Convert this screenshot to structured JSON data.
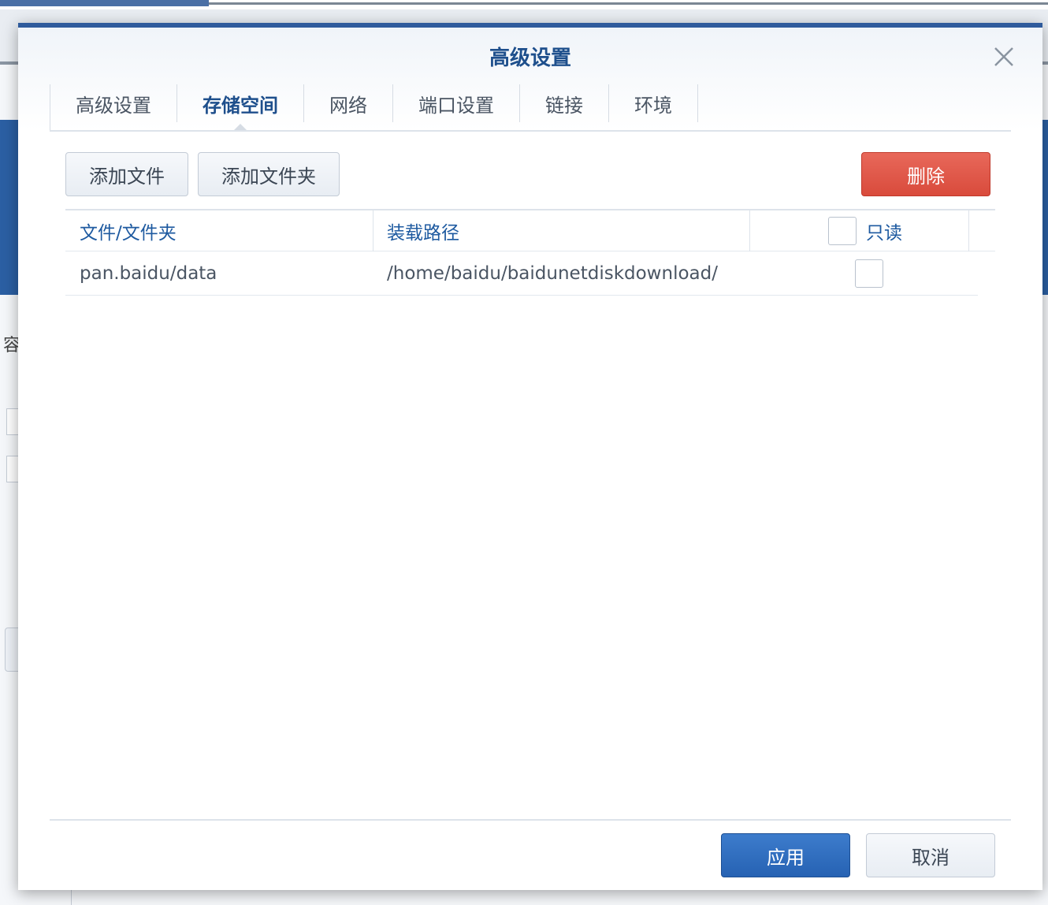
{
  "background": {
    "side_text": "容"
  },
  "dialog": {
    "title": "高级设置",
    "tabs": [
      {
        "label": "高级设置",
        "active": false
      },
      {
        "label": "存储空间",
        "active": true
      },
      {
        "label": "网络",
        "active": false
      },
      {
        "label": "端口设置",
        "active": false
      },
      {
        "label": "链接",
        "active": false
      },
      {
        "label": "环境",
        "active": false
      }
    ],
    "toolbar": {
      "add_file": "添加文件",
      "add_folder": "添加文件夹",
      "delete": "删除"
    },
    "table": {
      "columns": [
        "文件/文件夹",
        "装载路径",
        "只读"
      ],
      "rows": [
        {
          "file": "pan.baidu/data",
          "mount_path": "/home/baidu/baidunetdiskdownload/",
          "read_only": false
        }
      ]
    },
    "footer": {
      "apply": "应用",
      "cancel": "取消"
    }
  },
  "colors": {
    "accent": "#2f5b9c",
    "delete": "#d94b3c",
    "apply": "#2662b3"
  }
}
